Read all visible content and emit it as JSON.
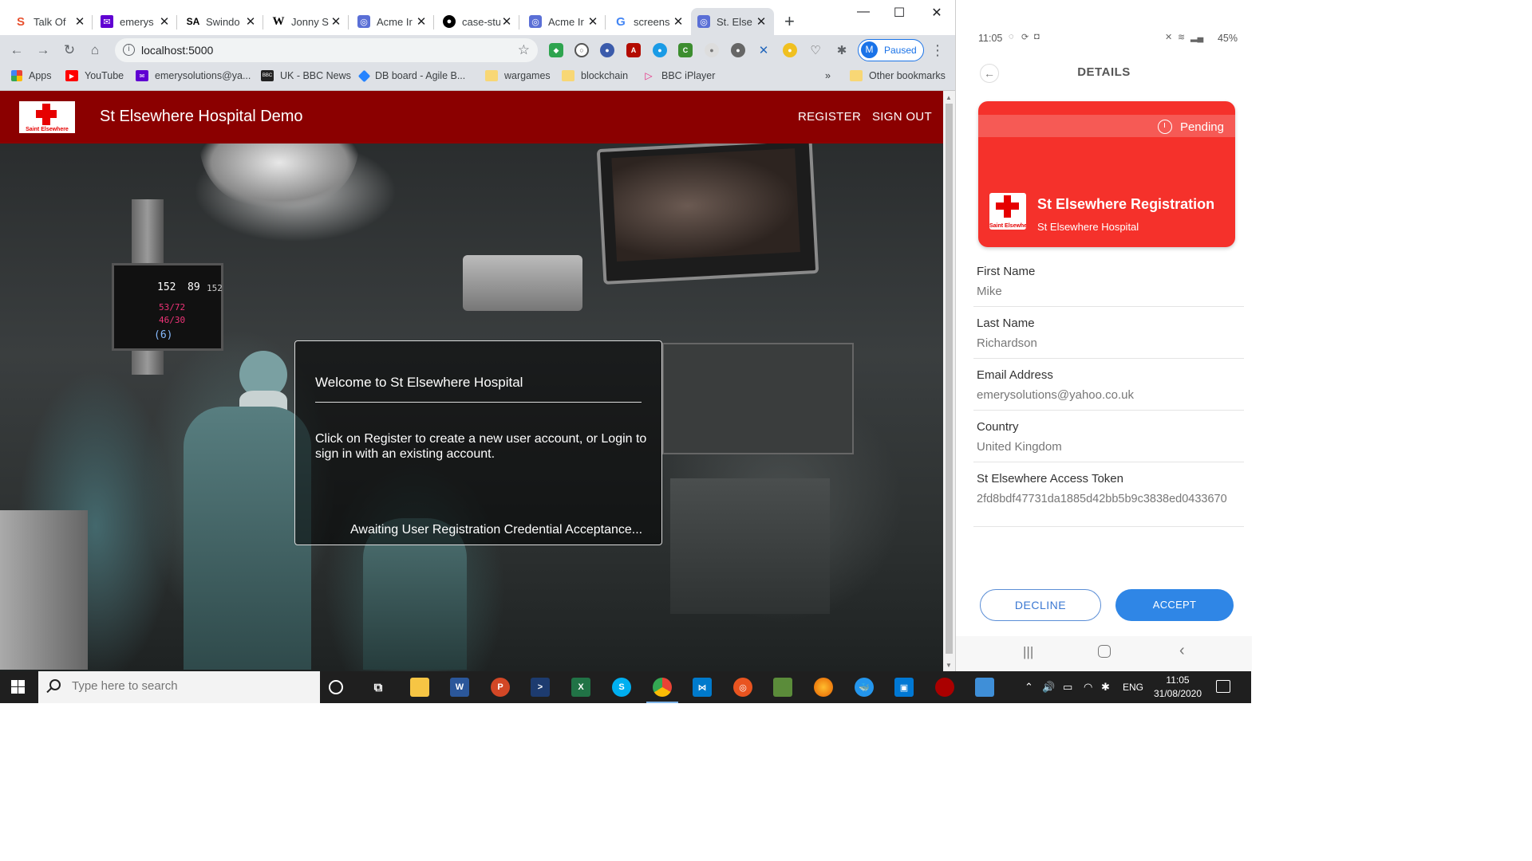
{
  "browser": {
    "tabs": [
      {
        "label": "Talk Of",
        "icon": "s-icon",
        "fav": "S",
        "color": "#e8512f"
      },
      {
        "label": "emerys",
        "icon": "yahoo-mail-icon",
        "fav": "✉",
        "color": "#6001d2"
      },
      {
        "label": "Swindo",
        "icon": "sa-icon",
        "fav": "SA",
        "color": "#000000"
      },
      {
        "label": "Jonny S",
        "icon": "wikipedia-icon",
        "fav": "W",
        "color": "#000000"
      },
      {
        "label": "Acme Ir",
        "icon": "acme-icon",
        "fav": "◎",
        "color": "#5a6fd6"
      },
      {
        "label": "case-stu",
        "icon": "github-icon",
        "fav": "●",
        "color": "#000000"
      },
      {
        "label": "Acme Ir",
        "icon": "acme-icon",
        "fav": "◎",
        "color": "#5a6fd6"
      },
      {
        "label": "screens",
        "icon": "google-icon",
        "fav": "G",
        "color": "#4285f4"
      },
      {
        "label": "St. Else",
        "icon": "st-elsewhere-icon",
        "fav": "◎",
        "color": "#5a6fd6",
        "active": true
      }
    ],
    "url": "localhost:5000",
    "profile_label": "Paused",
    "profile_initial": "M",
    "bookmarks": [
      {
        "label": "Apps",
        "icon": "apps-grid-icon"
      },
      {
        "label": "YouTube",
        "icon": "youtube-icon"
      },
      {
        "label": "emerysolutions@ya...",
        "icon": "yahoo-mail-icon"
      },
      {
        "label": "UK - BBC News",
        "icon": "bbc-icon"
      },
      {
        "label": "DB board - Agile B...",
        "icon": "jira-icon"
      },
      {
        "label": "wargames",
        "icon": "folder-icon"
      },
      {
        "label": "blockchain",
        "icon": "folder-icon"
      },
      {
        "label": "BBC iPlayer",
        "icon": "iplayer-icon"
      },
      {
        "label": "»",
        "icon": "overflow-icon"
      },
      {
        "label": "Other bookmarks",
        "icon": "folder-icon"
      }
    ]
  },
  "app": {
    "title": "St Elsewhere Hospital Demo",
    "logo_text": "Saint Elsewhere",
    "nav": {
      "register": "REGISTER",
      "signout": "SIGN OUT"
    },
    "welcome": {
      "title": "Welcome to St Elsewhere Hospital",
      "body": "Click on Register to create a new user account, or Login to sign in with an existing account.",
      "status": "Awaiting User Registration Credential Acceptance..."
    },
    "vitals": [
      "152",
      "89",
      "152",
      "53/72",
      "46/30",
      "(6)"
    ]
  },
  "phone": {
    "time": "11:05",
    "battery": "45%",
    "title": "DETAILS",
    "card": {
      "status": "Pending",
      "name": "St Elsewhere Registration",
      "issuer": "St Elsewhere Hospital",
      "logo_text": "Saint Elsewhere",
      "color": "#f5312b"
    },
    "fields": [
      {
        "label": "First Name",
        "value": "Mike"
      },
      {
        "label": "Last Name",
        "value": "Richardson"
      },
      {
        "label": "Email Address",
        "value": "emerysolutions@yahoo.co.uk"
      },
      {
        "label": "Country",
        "value": "United Kingdom"
      },
      {
        "label": "St Elsewhere Access Token",
        "value": "2fd8bdf47731da1885d42bb5b9c3838ed0433670"
      }
    ],
    "decline": "DECLINE",
    "accept": "ACCEPT"
  },
  "taskbar": {
    "search_placeholder": "Type here to search",
    "lang": "ENG",
    "time": "11:05",
    "date": "31/08/2020"
  }
}
